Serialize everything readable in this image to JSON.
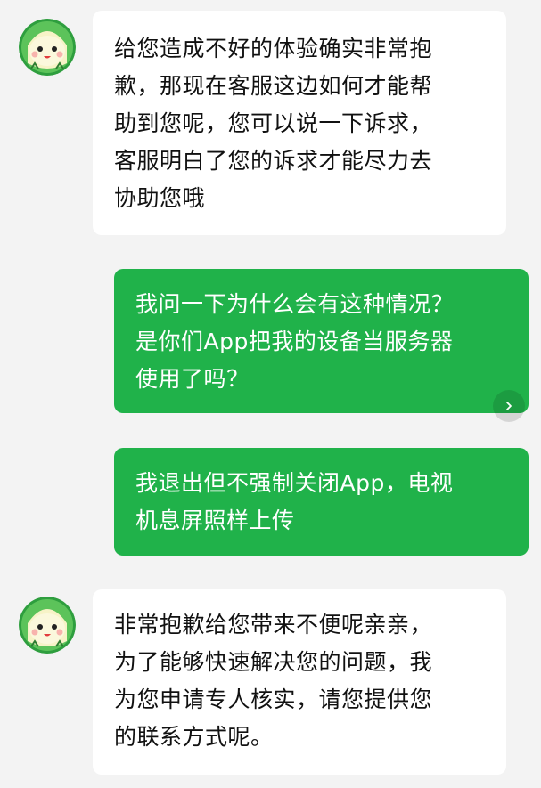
{
  "colors": {
    "background": "#f3f3f3",
    "incoming_bubble": "#ffffff",
    "outgoing_bubble": "#20b24a",
    "incoming_text": "#111111",
    "outgoing_text": "#ffffff"
  },
  "messages": [
    {
      "side": "left",
      "avatar_icon": "cartoon-melon-avatar-icon",
      "lines": [
        "给您造成不好的体验确实非常抱",
        "歉，那现在客服这边如何才能帮",
        "助到您呢，您可以说一下诉求，",
        "客服明白了您的诉求才能尽力去",
        "协助您哦"
      ]
    },
    {
      "side": "right",
      "lines": [
        "我问一下为什么会有这种情况？",
        "是你们App把我的设备当服务器",
        "使用了吗？"
      ],
      "more_icon": "chevron-right-icon"
    },
    {
      "side": "right",
      "lines": [
        "我退出但不强制关闭App，电视",
        "机息屏照样上传"
      ]
    },
    {
      "side": "left",
      "avatar_icon": "cartoon-melon-avatar-icon",
      "lines": [
        "非常抱歉给您带来不便呢亲亲，",
        "为了能够快速解决您的问题，我",
        "为您申请专人核实，请您提供您",
        "的联系方式呢。"
      ]
    }
  ]
}
